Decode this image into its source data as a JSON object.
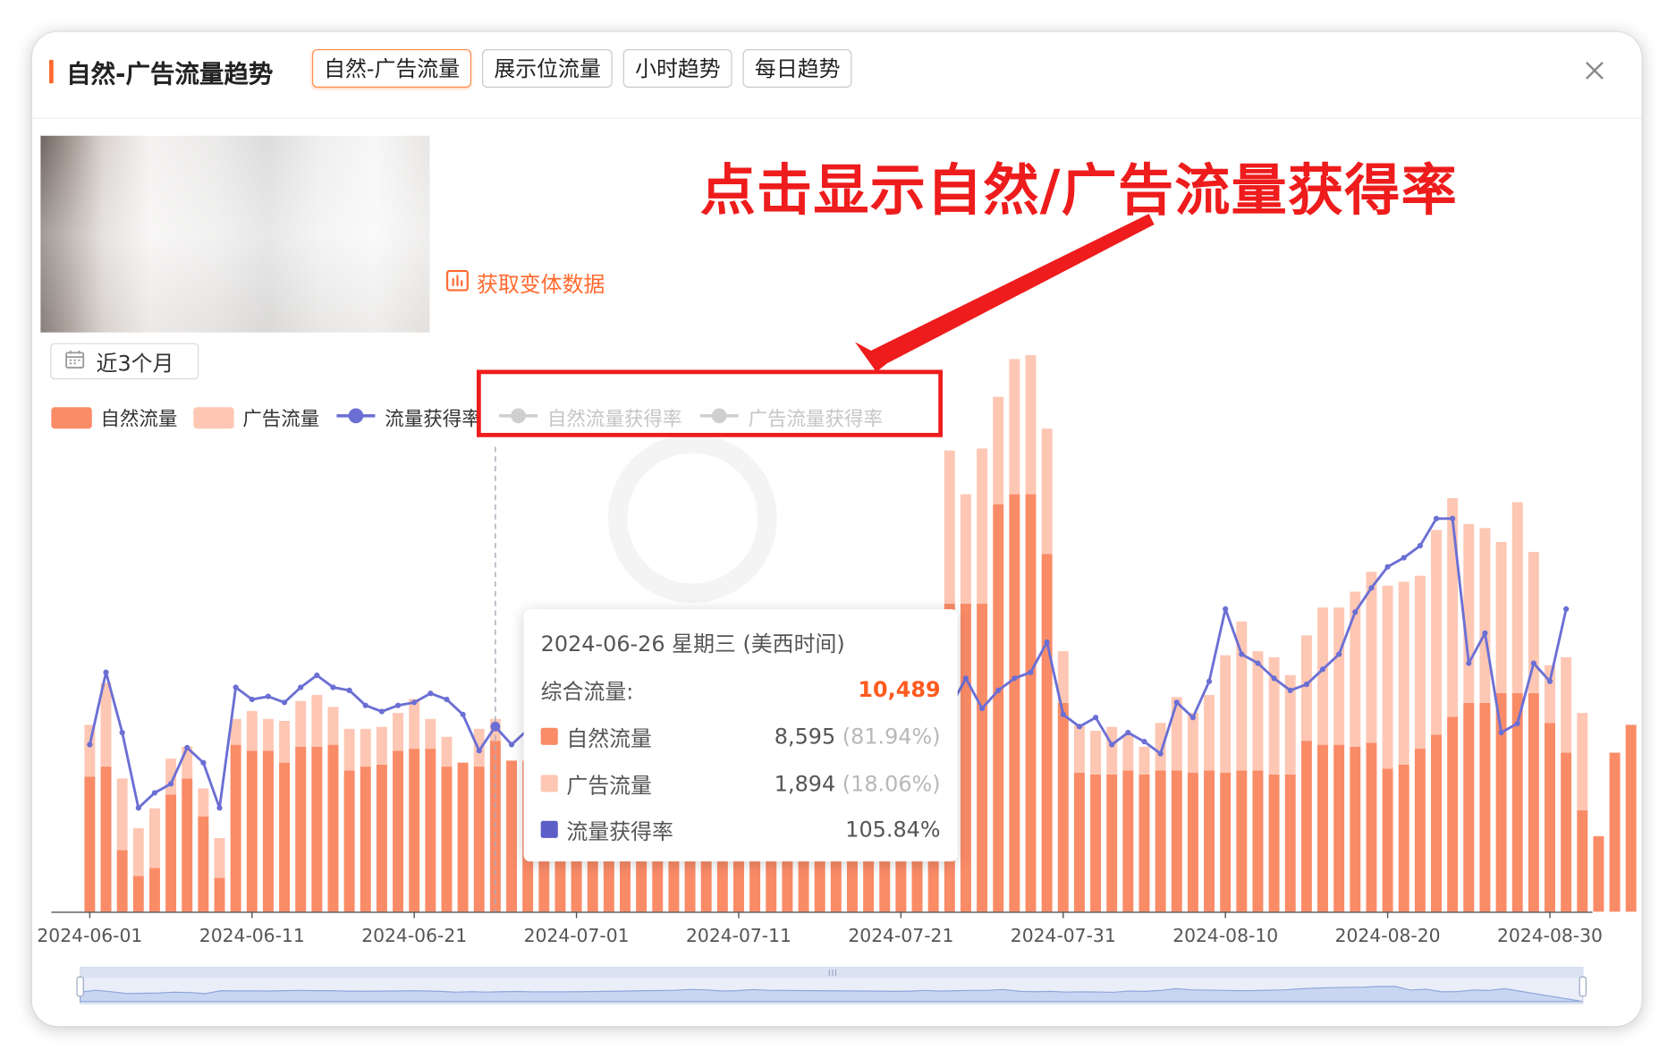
{
  "header": {
    "title": "自然-广告流量趋势",
    "tabs": [
      {
        "label": "自然-广告流量",
        "active": true
      },
      {
        "label": "展示位流量",
        "active": false
      },
      {
        "label": "小时趋势",
        "active": false
      },
      {
        "label": "每日趋势",
        "active": false
      }
    ],
    "close_icon": "close-icon"
  },
  "variant_button": {
    "label": "获取变体数据",
    "icon": "bar-chart-icon"
  },
  "date_range": {
    "label": "近3个月",
    "icon": "calendar-icon"
  },
  "annotation": {
    "text": "点击显示自然/广告流量获得率"
  },
  "legend": [
    {
      "label": "自然流量",
      "color": "#fa8b67",
      "type": "bar",
      "active": true
    },
    {
      "label": "广告流量",
      "color": "#fdc7b4",
      "type": "bar",
      "active": true
    },
    {
      "label": "流量获得率",
      "color": "#6b6fd4",
      "type": "line",
      "active": true
    },
    {
      "label": "自然流量获得率",
      "color": "#c5c5c5",
      "type": "line",
      "active": false
    },
    {
      "label": "广告流量获得率",
      "color": "#c5c5c5",
      "type": "line",
      "active": false
    }
  ],
  "tooltip": {
    "date": "2024-06-26 星期三 (美西时间)",
    "total_label": "综合流量:",
    "total_value": "10,489",
    "rows": [
      {
        "label": "自然流量",
        "value": "8,595",
        "pct": "(81.94%)",
        "color": "#fa8b67"
      },
      {
        "label": "广告流量",
        "value": "1,894",
        "pct": "(18.06%)",
        "color": "#fdc7b4"
      },
      {
        "label": "流量获得率",
        "value": "105.84%",
        "pct": "",
        "color": "#5b5fc7"
      }
    ]
  },
  "chart_data": {
    "type": "bar",
    "x_tick_labels": [
      "2024-06-01",
      "2024-06-11",
      "2024-06-21",
      "2024-07-01",
      "2024-07-11",
      "2024-07-21",
      "2024-07-31",
      "2024-08-10",
      "2024-08-20",
      "2024-08-30"
    ],
    "x_tick_indices": [
      0,
      10,
      20,
      30,
      40,
      50,
      60,
      70,
      80,
      90
    ],
    "stacked": true,
    "series": [
      {
        "name": "自然流量",
        "type": "bar",
        "values": [
          6.8,
          7.3,
          3.1,
          1.8,
          2.2,
          5.9,
          6.7,
          4.8,
          1.7,
          8.4,
          8.1,
          8.1,
          7.5,
          8.3,
          8.3,
          8.4,
          7.1,
          7.3,
          7.4,
          8.1,
          8.2,
          8.2,
          7.3,
          7.5,
          7.3,
          8.6,
          7.6,
          7.6,
          7.6,
          7.6,
          7.6,
          7.6,
          7.6,
          7.6,
          7.6,
          7.6,
          7.6,
          7.6,
          7.6,
          7.6,
          7.6,
          7.6,
          7.6,
          7.6,
          7.6,
          7.6,
          7.6,
          7.6,
          7.6,
          7.6,
          7.6,
          7.6,
          7.6,
          15.5,
          15.5,
          15.5,
          20.5,
          21.0,
          21.0,
          18.0,
          10.5,
          7.0,
          6.9,
          6.9,
          7.1,
          6.9,
          7.1,
          7.1,
          7.0,
          7.1,
          7.0,
          7.1,
          7.1,
          6.9,
          6.9,
          8.6,
          8.4,
          8.4,
          8.3,
          8.5,
          7.2,
          7.4,
          8.2,
          8.9,
          9.8,
          10.5,
          10.5,
          11.0,
          11.0,
          11.0,
          9.5,
          8.0,
          5.1,
          3.8,
          8.0,
          9.4,
          9.2
        ],
        "note_units": "thousands (tooltip 2024-06-26: 8,595)"
      },
      {
        "name": "广告流量",
        "type": "bar",
        "values": [
          2.6,
          4.2,
          3.6,
          2.4,
          3.0,
          1.8,
          1.6,
          1.4,
          2.0,
          1.3,
          2.0,
          1.6,
          2.1,
          2.3,
          2.6,
          1.9,
          2.1,
          1.9,
          1.9,
          1.9,
          2.5,
          1.5,
          1.5,
          0,
          1.9,
          1.1,
          0,
          0,
          0,
          0,
          0,
          0,
          0,
          0,
          0,
          0,
          0,
          0,
          0,
          0,
          0,
          0,
          0,
          0,
          0,
          0,
          0,
          0,
          0,
          0,
          0,
          6.0,
          7.6,
          7.7,
          5.5,
          7.8,
          5.4,
          6.8,
          7.0,
          6.3,
          2.6,
          2.4,
          2.2,
          2.4,
          1.8,
          1.4,
          2.4,
          3.7,
          3.0,
          3.8,
          5.9,
          7.5,
          6.0,
          5.9,
          5.0,
          5.3,
          6.9,
          6.9,
          7.8,
          8.6,
          9.2,
          9.2,
          8.7,
          10.3,
          11.0,
          9.0,
          8.8,
          7.6,
          9.6,
          7.1,
          2.9,
          4.8,
          4.9
        ],
        "note_units": "thousands (tooltip 2024-06-26: 1,894)"
      },
      {
        "name": "流量获得率",
        "type": "line",
        "values": [
          106,
          130,
          110,
          85,
          90,
          93,
          105,
          100,
          85,
          125,
          121,
          122,
          120,
          125,
          129,
          125,
          124,
          119,
          117,
          119,
          120,
          123,
          121,
          116,
          104,
          112,
          106,
          111,
          114,
          108,
          110,
          110,
          112,
          114,
          117,
          120,
          124,
          126,
          130,
          140,
          135,
          120,
          125,
          140,
          128,
          127,
          126,
          125,
          123,
          122,
          120,
          118,
          116,
          118,
          128,
          118,
          124,
          128,
          130,
          140,
          116,
          112,
          115,
          106,
          110,
          107,
          103,
          120,
          115,
          127,
          151,
          136,
          133,
          128,
          124,
          126,
          131,
          136,
          150,
          158,
          165,
          168,
          172,
          181,
          181,
          133,
          143,
          110,
          113,
          133,
          127,
          151
        ],
        "unit": "%"
      },
      {
        "name": "自然流量获得率",
        "type": "line",
        "hidden": true,
        "values": []
      },
      {
        "name": "广告流量获得率",
        "type": "line",
        "hidden": true,
        "values": []
      }
    ],
    "highlight": {
      "category": "2024-06-26"
    },
    "datazoom": {
      "range": "full"
    }
  }
}
